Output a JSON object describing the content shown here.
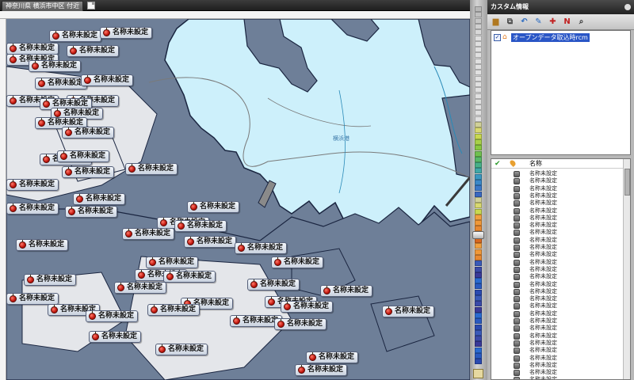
{
  "map": {
    "tab_title": "神奈川県 横浜市中区 付近",
    "sea_label": "横浜港",
    "poi_label": "名称未設定",
    "poi_icon": "apple-marker-icon",
    "colors": {
      "sea": "#cdf0fb",
      "land": "#6e7f98",
      "coast": "#1a2540"
    }
  },
  "panel": {
    "title": "カスタム情報",
    "toolbar_icons": [
      "folder-icon",
      "layer-add-icon",
      "undo-icon",
      "edit-icon",
      "add-marker-icon",
      "marker-name-icon",
      "search-zoom-icon"
    ],
    "toolbar_glyphs": [
      "▆",
      "⧉",
      "↶",
      "✎",
      "✚",
      "N",
      "⌕"
    ],
    "tree_item": "オープンデータ取込時rcm",
    "list_header": "名称",
    "list_items": [
      "名称未設定",
      "名称未設定",
      "名称未設定",
      "名称未設定",
      "名称未設定",
      "名称未設定",
      "名称未設定",
      "名称未設定",
      "名称未設定",
      "名称未設定",
      "名称未設定",
      "名称未設定",
      "名称未設定",
      "名称未設定",
      "名称未設定",
      "名称未設定",
      "名称未設定",
      "名称未設定",
      "名称未設定",
      "名称未設定",
      "名称未設定",
      "名称未設定",
      "名称未設定",
      "名称未設定",
      "名称未設定",
      "名称未設定",
      "名称未設定",
      "名称未設定",
      "名称未設定",
      "名称未設定"
    ]
  }
}
